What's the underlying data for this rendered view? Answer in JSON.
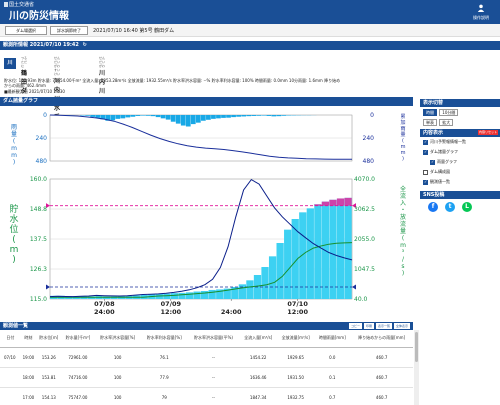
{
  "header": {
    "agency": "国土交通省",
    "title": "川の防災情報",
    "menu_label": "操作説明"
  },
  "toolbar": {
    "btn_select": "ダム場選択",
    "btn_end": "詳水調節終了",
    "info": "2021/07/10 16:40 第5号 鶴田ダム"
  },
  "section_station": {
    "title": "観測所情報 2021/07/10 19:42"
  },
  "station": {
    "logo": "川",
    "dam_ruby": "つるただむ",
    "dam_name": "鶴田ダム",
    "river_sys_ruby": "せんだいがわすいけい",
    "river_sys_name": "川内川水系",
    "river_ruby": "せんだいがわ",
    "river_name": "川内川"
  },
  "info_line": "貯水位: 152.93m  貯水量: 71654.00千m³  全流入量: 1353.28m³/s  全放流量: 1932.55m³/s  貯水率洪水容量: --%  貯水率利水容量: 100%  時間雨量: 0.0mm  10分雨量: 1.6mm  降り始め",
  "info_line2": "からの雨量: 462.4mm",
  "latest_label": "■最新観測値 2021/07/10 19:30",
  "chart_section_title": "ダム諸量グラフ",
  "chart_data": {
    "type": "line",
    "rain_axis": {
      "label": "雨量(mm)",
      "ticks": [
        "0",
        "240",
        "480"
      ],
      "ylim": [
        480,
        0
      ]
    },
    "level_axis": {
      "label": "貯水位(m)",
      "ticks": [
        "160.0",
        "148.8",
        "137.5",
        "126.3",
        "115.0"
      ],
      "ylim": [
        115.0,
        160.0
      ]
    },
    "flow_axis": {
      "label": "全流入・放流量(m³/s)",
      "ticks": [
        "4070.0",
        "3062.5",
        "2055.0",
        "1047.5",
        "40.0"
      ],
      "ylim": [
        40.0,
        4070.0
      ]
    },
    "cum_rain_axis_label": "累加雨量(mm)",
    "x_ticks": [
      {
        "line1": "07/08",
        "line2": "24:00"
      },
      {
        "line1": "07/09",
        "line2": "12:00"
      },
      {
        "line1": "",
        "line2": "24:00"
      },
      {
        "line1": "07/10",
        "line2": "12:00"
      }
    ],
    "hourly_rain": [
      0,
      0,
      2,
      4,
      1,
      0,
      5,
      8,
      20,
      30,
      45,
      60,
      55,
      40,
      35,
      25,
      18,
      10,
      6,
      8,
      12,
      22,
      35,
      48,
      70,
      90,
      110,
      120,
      95,
      80,
      60,
      50,
      40,
      35,
      30,
      28,
      22,
      18,
      15,
      12,
      10,
      8,
      6,
      10,
      14,
      12,
      8,
      5,
      4,
      3,
      2,
      2,
      1,
      0,
      0,
      0,
      0,
      0,
      0,
      0
    ],
    "cumulative_rain": [
      0,
      2,
      6,
      10,
      20,
      30,
      45,
      65,
      95,
      130,
      170,
      210,
      245,
      275,
      300,
      320,
      335,
      345,
      352,
      360,
      372,
      385,
      400,
      415,
      430,
      440,
      448,
      452,
      456,
      458,
      460,
      461,
      462,
      462.4
    ],
    "water_level": [
      116.2,
      116.2,
      116.1,
      116.1,
      116.0,
      116.0,
      116.1,
      116.0,
      116.0,
      116.1,
      116.2,
      116.3,
      116.5,
      116.7,
      116.9,
      117.0,
      117.2,
      117.3,
      117.5,
      117.8,
      118.0,
      118.4,
      118.6,
      118.9,
      119.5,
      120.5,
      122.0,
      124.0,
      127.0,
      131.0,
      136.0,
      141.0,
      145.0,
      147.5,
      149.0,
      150.5,
      151.5,
      152.2,
      152.7,
      152.93
    ],
    "inflow": [
      120,
      130,
      125,
      120,
      130,
      140,
      160,
      150,
      145,
      140,
      150,
      170,
      190,
      200,
      210,
      230,
      260,
      300,
      350,
      420,
      520,
      700,
      1100,
      1800,
      2800,
      3700,
      4050,
      3900,
      3500,
      3100,
      2800,
      2550,
      2300,
      2100,
      1900,
      1750,
      1600,
      1500,
      1420,
      1353.28
    ],
    "outflow": [
      100,
      100,
      100,
      100,
      100,
      100,
      100,
      100,
      100,
      100,
      100,
      100,
      100,
      120,
      140,
      150,
      160,
      180,
      200,
      220,
      240,
      270,
      300,
      340,
      380,
      420,
      450,
      480,
      520,
      600,
      800,
      1100,
      1400,
      1600,
      1750,
      1820,
      1880,
      1910,
      1925,
      1932.55
    ],
    "reference_lines": [
      {
        "name": "洪水時最高水位",
        "value": 150.0,
        "color": "#e0149a"
      },
      {
        "name": "最低水位",
        "value": 119.5,
        "color": "#1a2f9b"
      }
    ],
    "colors": {
      "rain": "#18a8e6",
      "cumulative": "#1a2f9b",
      "inflow": "#0b1f8a",
      "outflow": "#17902c",
      "level_fill": "#3dd1f2",
      "flood_fill": "#cc44aa",
      "plot_bg": "#ffffff"
    }
  },
  "side": {
    "display_title": "表示切替",
    "display_mode_label": "時間",
    "display_mode_options": [
      "10分間",
      "単表",
      "拡大"
    ],
    "content_title": "内容表示",
    "content_badge": "内容リセット",
    "items": [
      {
        "label": "河川予警報情報一覧",
        "checked": true
      },
      {
        "label": "ダム諸量グラフ",
        "checked": true
      },
      {
        "label": "雨量グラフ",
        "checked": true
      },
      {
        "label": "ダム構成図",
        "checked": false
      },
      {
        "label": "観測値一覧",
        "checked": true
      }
    ],
    "sns_title": "SNS投稿",
    "sns": [
      {
        "icon": "facebook-icon",
        "color": "#1877f2",
        "glyph": "f"
      },
      {
        "icon": "twitter-icon",
        "color": "#1da1f2",
        "glyph": "t"
      },
      {
        "icon": "line-icon",
        "color": "#06c755",
        "glyph": "L"
      }
    ]
  },
  "table": {
    "title": "観測値一覧",
    "actions": [
      "コピー",
      "印刷",
      "表示一覧",
      "全体表示"
    ],
    "headers": [
      "日付",
      "時刻",
      "貯水位[m]",
      "貯水量[千m³]",
      "貯水率洪水容量[%]",
      "貯水率利水容量[%]",
      "貯水率洪水容量(平%)",
      "全流入量[m³/s]",
      "全放流量[m³/s]",
      "時間雨量[mm]",
      "降り始めからの雨量[mm]"
    ],
    "rows": [
      [
        "07/10",
        "19:00",
        "153.26",
        "72961.00",
        "100",
        "76.1",
        "--",
        "1454.22",
        "1929.65",
        "0.0",
        "460.7"
      ],
      [
        "",
        "18:00",
        "153.81",
        "74716.00",
        "100",
        "77.9",
        "--",
        "1636.46",
        "1931.50",
        "0.1",
        "460.7"
      ],
      [
        "",
        "17:00",
        "154.13",
        "75747.00",
        "100",
        "79",
        "--",
        "1847.34",
        "1932.75",
        "0.7",
        "460.7"
      ]
    ]
  }
}
